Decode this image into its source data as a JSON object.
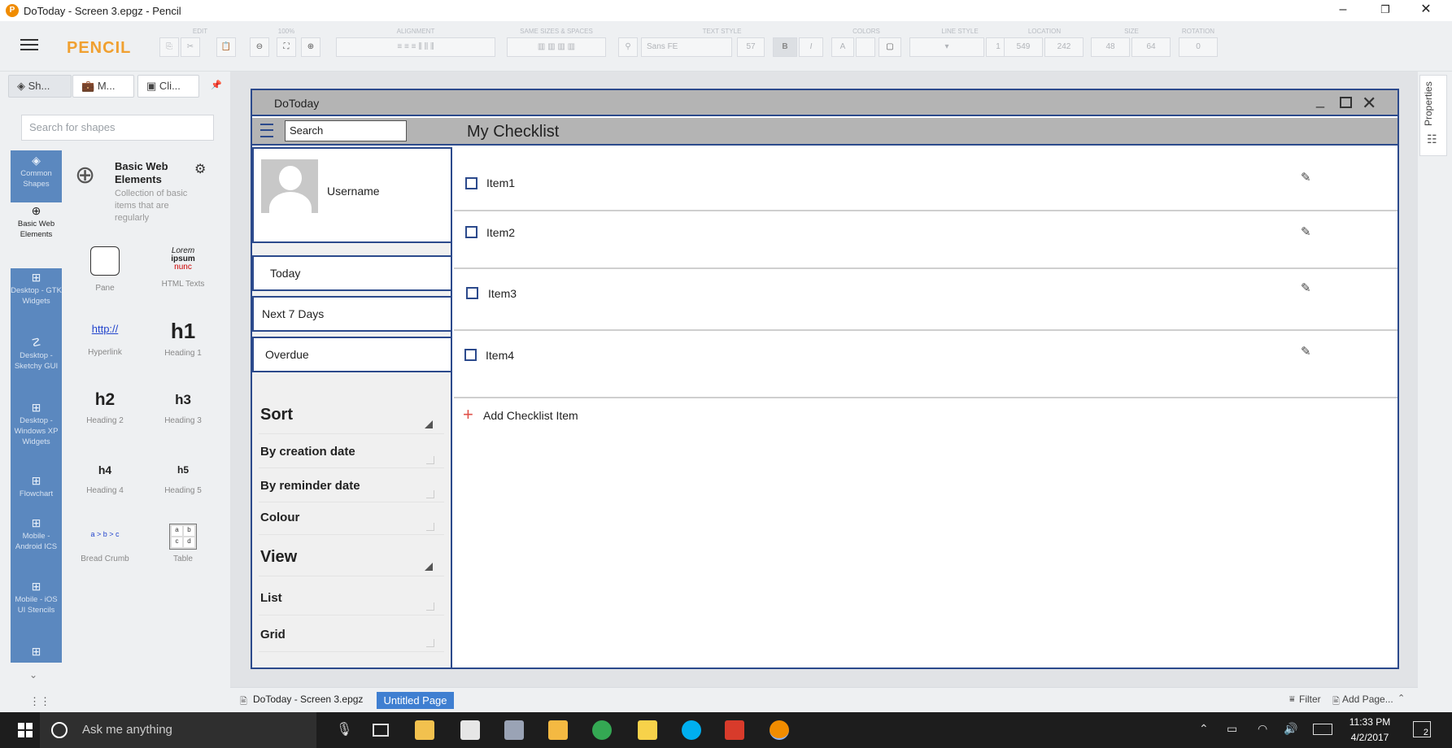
{
  "window": {
    "title": "DoToday - Screen 3.epgz - Pencil",
    "minimize": "–",
    "restore": "❐",
    "close": "✕"
  },
  "toolbar": {
    "brand": "PENCIL",
    "groups": {
      "edit": "EDIT",
      "zoom": "100%",
      "alignment": "ALIGNMENT",
      "same_sizes": "SAME SIZES & SPACES",
      "text_style": "TEXT STYLE",
      "colors": "COLORS",
      "line_style": "LINE STYLE",
      "location": "LOCATION",
      "size": "SIZE",
      "rotation": "ROTATION"
    },
    "font_name": "Sans FE",
    "font_size": "57",
    "bold": "B",
    "italic": "I",
    "line_width": "1",
    "loc_x": "549",
    "loc_y": "242",
    "size_w": "48",
    "size_h": "64",
    "rotation": "0"
  },
  "left_panel": {
    "tabs": [
      "Sh...",
      "M...",
      "Cli..."
    ],
    "search_placeholder": "Search for shapes",
    "categories": [
      {
        "label": "Common Shapes",
        "icon": "layers-icon"
      },
      {
        "label": "Basic Web Elements",
        "icon": "globe-icon"
      },
      {
        "label": "Desktop - GTK Widgets",
        "icon": "grid-icon"
      },
      {
        "label": "Desktop - Sketchy GUI",
        "icon": "sketch-icon"
      },
      {
        "label": "Desktop - Windows XP Widgets",
        "icon": "grid-icon"
      },
      {
        "label": "Flowchart",
        "icon": "grid-icon"
      },
      {
        "label": "Mobile - Android ICS",
        "icon": "grid-icon"
      },
      {
        "label": "Mobile - iOS UI Stencils",
        "icon": "grid-icon"
      }
    ],
    "collection": {
      "title": "Basic Web Elements",
      "description": "Collection of basic items that are regularly"
    },
    "shapes": [
      {
        "label": "Pane"
      },
      {
        "label": "HTML Texts",
        "preview": [
          "Lorem",
          "ipsum",
          "nunc"
        ]
      },
      {
        "label": "Hyperlink",
        "preview": "http://"
      },
      {
        "label": "Heading 1",
        "preview": "h1"
      },
      {
        "label": "Heading 2",
        "preview": "h2"
      },
      {
        "label": "Heading 3",
        "preview": "h3"
      },
      {
        "label": "Heading 4",
        "preview": "h4"
      },
      {
        "label": "Heading 5",
        "preview": "h5"
      },
      {
        "label": "Bread Crumb",
        "preview": "a > b > c"
      },
      {
        "label": "Table",
        "preview": [
          "a",
          "b",
          "c",
          "d"
        ]
      }
    ]
  },
  "mockup": {
    "app_title": "DoToday",
    "search": "Search",
    "heading": "My Checklist",
    "username": "Username",
    "nav": [
      "Today",
      "Next 7 Days",
      "Overdue"
    ],
    "sort": {
      "title": "Sort",
      "items": [
        "By creation date",
        "By reminder date",
        "Colour"
      ]
    },
    "view": {
      "title": "View",
      "items": [
        "List",
        "Grid"
      ]
    },
    "items": [
      "Item1",
      "Item2",
      "Item3",
      "Item4"
    ],
    "add_label": "Add Checklist Item"
  },
  "bottom": {
    "document": "DoToday - Screen 3.epgz",
    "page": "Untitled Page",
    "filter": "Filter",
    "add_page": "Add Page..."
  },
  "properties_label": "Properties",
  "taskbar": {
    "search": "Ask me anything",
    "time": "11:33 PM",
    "date": "4/2/2017",
    "notifications": "2"
  }
}
